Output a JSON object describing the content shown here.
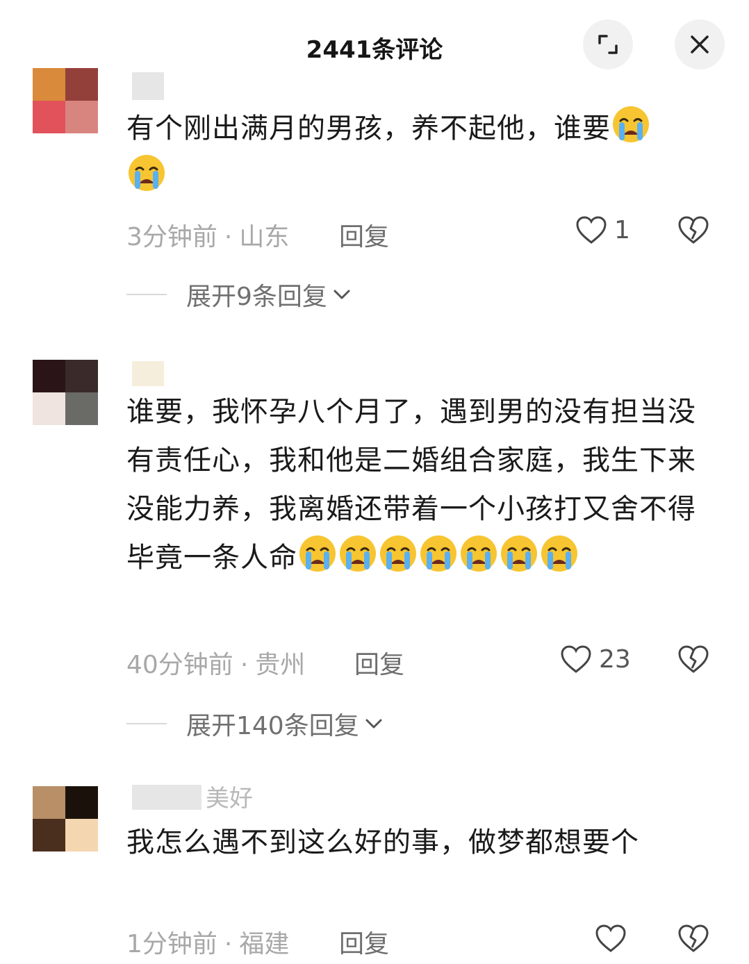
{
  "header": {
    "title": "2441条评论"
  },
  "comments": [
    {
      "username": "",
      "text": "有个刚出满月的男孩，养不起他，谁要",
      "time": "3分钟前",
      "location": "山东",
      "reply_label": "回复",
      "likes": "1",
      "expand_label": "展开9条回复"
    },
    {
      "username": "",
      "text": "谁要，我怀孕八个月了，遇到男的没有担当没有责任心，我和他是二婚组合家庭，我生下来没能力养，我离婚还带着一个小孩打又舍不得毕竟一条人命",
      "time": "40分钟前",
      "location": "贵州",
      "reply_label": "回复",
      "likes": "23",
      "expand_label": "展开140条回复"
    },
    {
      "username": "美好",
      "text": "我怎么遇不到这么好的事，做梦都想要个",
      "time": "1分钟前",
      "location": "福建",
      "reply_label": "回复",
      "likes": ""
    }
  ],
  "icons": {
    "expand": "expand-screen-icon",
    "close": "close-icon",
    "heart": "heart-outline-icon",
    "broken_heart": "broken-heart-icon",
    "chevron": "chevron-down-icon",
    "emoji": "loudly-crying-face-icon"
  },
  "colors": {
    "meta": "#a8a8a8",
    "text": "#1a1a1a",
    "emoji": "#f7c531",
    "tear": "#5ab0f0"
  }
}
